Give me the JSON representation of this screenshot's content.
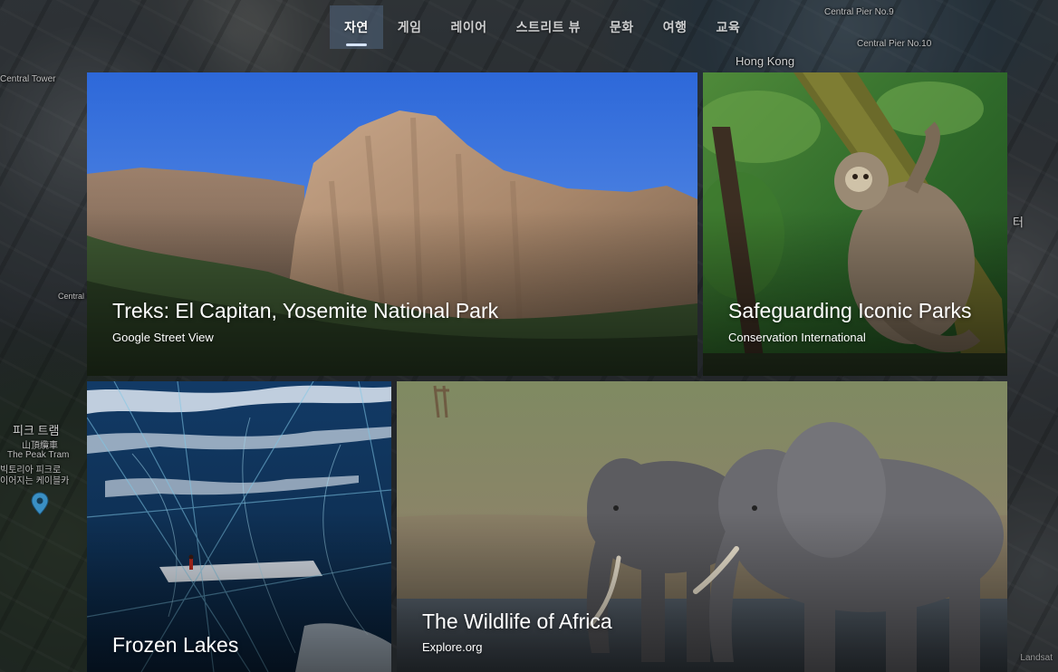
{
  "map": {
    "labels": {
      "central_pier_9": "Central Pier No.9",
      "central_pier_10": "Central Pier No.10",
      "hong_kong": "Hong Kong",
      "central_tower": "Central Tower",
      "central_office": "Central\nOffice",
      "peak_tram_kr": "피크 트램",
      "peak_tram_zh": "山頂纜車",
      "peak_tram_en": "The Peak Tram",
      "peak_tram_desc1": "빅토리아 피크로",
      "peak_tram_desc2": "이어지는 케이블카",
      "right_kr": "터",
      "landsat": "Landsat"
    },
    "colors": {
      "pin": "#3a8fc4"
    }
  },
  "tabs": [
    {
      "label": "자연",
      "active": true
    },
    {
      "label": "게임",
      "active": false
    },
    {
      "label": "레이어",
      "active": false
    },
    {
      "label": "스트리트 뷰",
      "active": false
    },
    {
      "label": "문화",
      "active": false
    },
    {
      "label": "여행",
      "active": false
    },
    {
      "label": "교육",
      "active": false
    }
  ],
  "cards": {
    "yosemite": {
      "title": "Treks: El Capitan, Yosemite National Park",
      "source": "Google Street View"
    },
    "sloth": {
      "title": "Safeguarding Iconic Parks",
      "source": "Conservation International"
    },
    "frozen": {
      "title": "Frozen Lakes"
    },
    "africa": {
      "title": "The Wildlife of Africa",
      "source": "Explore.org"
    }
  },
  "colors": {
    "active_tab_underline": "#d6e4ff",
    "active_tab_bg": "#506483",
    "card_title": "#ffffff"
  }
}
